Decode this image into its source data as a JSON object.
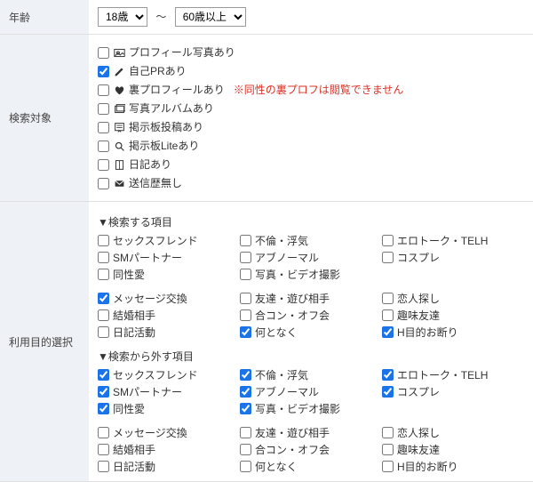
{
  "age": {
    "label": "年齢",
    "from": "18歳",
    "to": "60歳以上",
    "tilde": "～"
  },
  "target": {
    "label": "検索対象",
    "items": [
      {
        "checked": false,
        "icon": "photo",
        "text": "プロフィール写真あり"
      },
      {
        "checked": true,
        "icon": "pencil",
        "text": "自己PRあり"
      },
      {
        "checked": false,
        "icon": "heart",
        "text": "裏プロフィールあり",
        "warn": "※同性の裏プロフは閲覧できません"
      },
      {
        "checked": false,
        "icon": "album",
        "text": "写真アルバムあり"
      },
      {
        "checked": false,
        "icon": "board",
        "text": "掲示板投稿あり"
      },
      {
        "checked": false,
        "icon": "search",
        "text": "掲示板Liteあり"
      },
      {
        "checked": false,
        "icon": "diary",
        "text": "日記あり"
      },
      {
        "checked": false,
        "icon": "mail",
        "text": "送信歴無し"
      }
    ]
  },
  "purpose": {
    "label": "利用目的選択",
    "include_title": "▼検索する項目",
    "exclude_title": "▼検索から外す項目",
    "groupA": [
      {
        "text": "セックスフレンド",
        "inc": false,
        "exc": true
      },
      {
        "text": "不倫・浮気",
        "inc": false,
        "exc": true
      },
      {
        "text": "エロトーク・TELH",
        "inc": false,
        "exc": true
      },
      {
        "text": "SMパートナー",
        "inc": false,
        "exc": true
      },
      {
        "text": "アブノーマル",
        "inc": false,
        "exc": true
      },
      {
        "text": "コスプレ",
        "inc": false,
        "exc": true
      },
      {
        "text": "同性愛",
        "inc": false,
        "exc": true
      },
      {
        "text": "写真・ビデオ撮影",
        "inc": false,
        "exc": true
      }
    ],
    "groupB": [
      {
        "text": "メッセージ交換",
        "inc": true,
        "exc": false
      },
      {
        "text": "友達・遊び相手",
        "inc": false,
        "exc": false
      },
      {
        "text": "恋人探し",
        "inc": false,
        "exc": false
      },
      {
        "text": "結婚相手",
        "inc": false,
        "exc": false
      },
      {
        "text": "合コン・オフ会",
        "inc": false,
        "exc": false
      },
      {
        "text": "趣味友達",
        "inc": false,
        "exc": false
      },
      {
        "text": "日記活動",
        "inc": false,
        "exc": false
      },
      {
        "text": "何となく",
        "inc": true,
        "exc": false
      },
      {
        "text": "H目的お断り",
        "inc": true,
        "exc": false
      }
    ]
  }
}
